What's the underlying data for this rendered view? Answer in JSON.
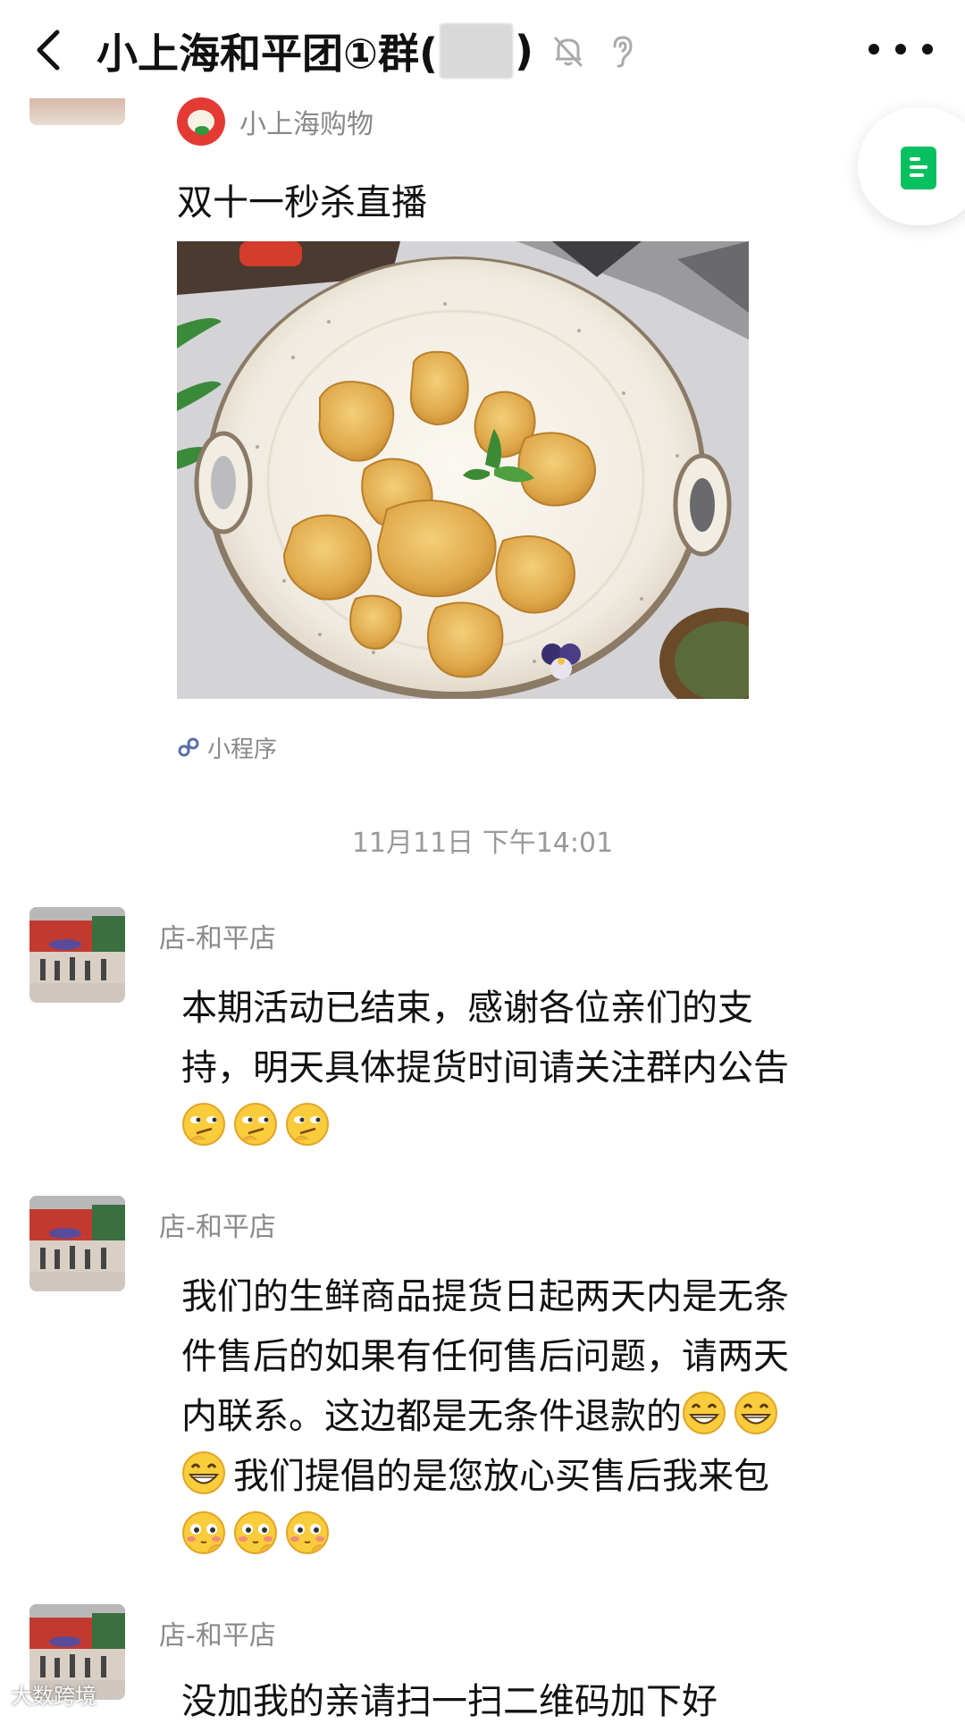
{
  "header": {
    "title": "小上海和平团①群(",
    "title_close": ")",
    "back_icon": "chevron-left-icon",
    "mute_icon": "bell-off-icon",
    "ear_icon": "ear-icon",
    "more_icon": "more-icon"
  },
  "mini_program": {
    "source_name": "小上海购物",
    "title": "双十一秒杀直播",
    "footer_label": "小程序",
    "footer_icon": "mini-program-icon"
  },
  "timestamp": "11月11日 下午14:01",
  "messages": [
    {
      "sender": "店-和平店",
      "text": "本期活动已结束，感谢各位亲们的支持，明天具体提货时间请关注群内公告",
      "emoji": "smirk-emoji"
    },
    {
      "sender": "店-和平店",
      "text_a": "我们的生鲜商品提货日起两天内是无条件售后的如果有任何售后问题，请两天内联系。这边都是无条件退款的",
      "emoji_a": "grin-emoji",
      "text_b": "我们提倡的是您放心买售后我来包",
      "emoji_b": "blush-emoji"
    },
    {
      "sender": "店-和平店",
      "text": "没加我的亲请扫一扫二维码加下好"
    }
  ],
  "watermark": "大数跨境",
  "colors": {
    "accent_green": "#07c160",
    "brand_red": "#e43a34"
  }
}
